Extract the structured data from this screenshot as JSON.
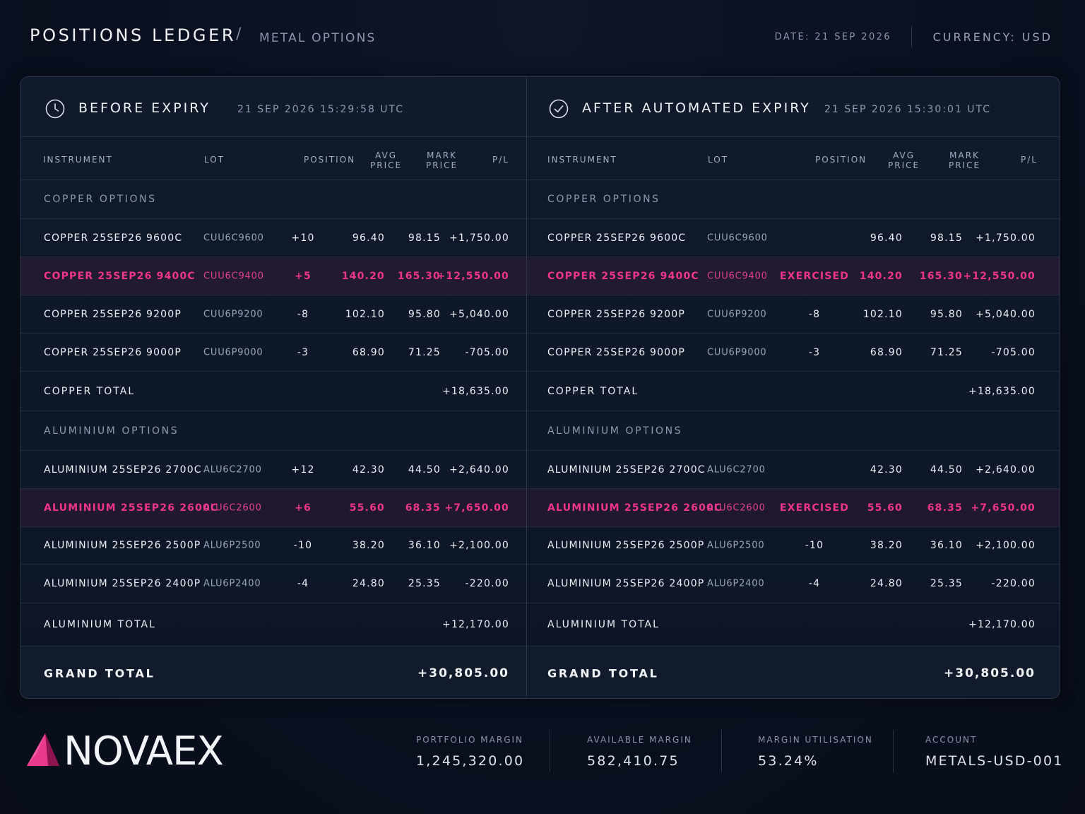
{
  "header": {
    "title": "POSITIONS LEDGER",
    "separator": "/",
    "subtitle": "METAL OPTIONS",
    "date": "DATE: 21 SEP 2026",
    "currency": "CURRENCY: USD"
  },
  "columns": {
    "instrument": "INSTRUMENT",
    "lot": "LOT",
    "position": "POSITION",
    "avg_l1": "AVG",
    "avg_l2": "PRICE",
    "mark_l1": "MARK",
    "mark_l2": "PRICE",
    "pl": "P/L"
  },
  "before": {
    "title": "BEFORE EXPIRY",
    "timestamp": "21 SEP 2026 15:29:58 UTC",
    "icon": "clock-icon",
    "copper_group": "COPPER OPTIONS",
    "copper_rows": [
      {
        "instrument": "COPPER 25SEP26 9600C",
        "lot": "CUU6C9600",
        "position": "+10",
        "avg": "96.40",
        "mark": "98.15",
        "pl": "+1,750.00"
      },
      {
        "instrument": "COPPER 25SEP26 9400C",
        "lot": "CUU6C9400",
        "position": "+5",
        "avg": "140.20",
        "mark": "165.30",
        "pl": "+12,550.00"
      },
      {
        "instrument": "COPPER 25SEP26 9200P",
        "lot": "CUU6P9200",
        "position": "-8",
        "avg": "102.10",
        "mark": "95.80",
        "pl": "+5,040.00"
      },
      {
        "instrument": "COPPER 25SEP26 9000P",
        "lot": "CUU6P9000",
        "position": "-3",
        "avg": "68.90",
        "mark": "71.25",
        "pl": "-705.00"
      }
    ],
    "copper_total_label": "COPPER TOTAL",
    "copper_total": "+18,635.00",
    "aluminium_group": "ALUMINIUM OPTIONS",
    "aluminium_rows": [
      {
        "instrument": "ALUMINIUM 25SEP26 2700C",
        "lot": "ALU6C2700",
        "position": "+12",
        "avg": "42.30",
        "mark": "44.50",
        "pl": "+2,640.00"
      },
      {
        "instrument": "ALUMINIUM 25SEP26 2600C",
        "lot": "ALU6C2600",
        "position": "+6",
        "avg": "55.60",
        "mark": "68.35",
        "pl": "+7,650.00"
      },
      {
        "instrument": "ALUMINIUM 25SEP26 2500P",
        "lot": "ALU6P2500",
        "position": "-10",
        "avg": "38.20",
        "mark": "36.10",
        "pl": "+2,100.00"
      },
      {
        "instrument": "ALUMINIUM 25SEP26 2400P",
        "lot": "ALU6P2400",
        "position": "-4",
        "avg": "24.80",
        "mark": "25.35",
        "pl": "-220.00"
      }
    ],
    "aluminium_total_label": "ALUMINIUM TOTAL",
    "aluminium_total": "+12,170.00",
    "grand_total_label": "GRAND TOTAL",
    "grand_total": "+30,805.00"
  },
  "after": {
    "title": "AFTER AUTOMATED EXPIRY",
    "timestamp": "21 SEP 2026 15:30:01 UTC",
    "icon": "check-circle-icon",
    "copper_group": "COPPER OPTIONS",
    "copper_rows": [
      {
        "instrument": "COPPER 25SEP26 9600C",
        "lot": "CUU6C9600",
        "position": "",
        "avg": "96.40",
        "mark": "98.15",
        "pl": "+1,750.00"
      },
      {
        "instrument": "COPPER 25SEP26 9400C",
        "lot": "CUU6C9400",
        "position": "EXERCISED",
        "avg": "140.20",
        "mark": "165.30",
        "pl": "+12,550.00"
      },
      {
        "instrument": "COPPER 25SEP26 9200P",
        "lot": "CUU6P9200",
        "position": "-8",
        "avg": "102.10",
        "mark": "95.80",
        "pl": "+5,040.00"
      },
      {
        "instrument": "COPPER 25SEP26 9000P",
        "lot": "CUU6P9000",
        "position": "-3",
        "avg": "68.90",
        "mark": "71.25",
        "pl": "-705.00"
      }
    ],
    "copper_total_label": "COPPER TOTAL",
    "copper_total": "+18,635.00",
    "aluminium_group": "ALUMINIUM OPTIONS",
    "aluminium_rows": [
      {
        "instrument": "ALUMINIUM 25SEP26 2700C",
        "lot": "ALU6C2700",
        "position": "",
        "avg": "42.30",
        "mark": "44.50",
        "pl": "+2,640.00"
      },
      {
        "instrument": "ALUMINIUM 25SEP26 2600C",
        "lot": "ALU6C2600",
        "position": "EXERCISED",
        "avg": "55.60",
        "mark": "68.35",
        "pl": "+7,650.00"
      },
      {
        "instrument": "ALUMINIUM 25SEP26 2500P",
        "lot": "ALU6P2500",
        "position": "-10",
        "avg": "38.20",
        "mark": "36.10",
        "pl": "+2,100.00"
      },
      {
        "instrument": "ALUMINIUM 25SEP26 2400P",
        "lot": "ALU6P2400",
        "position": "-4",
        "avg": "24.80",
        "mark": "25.35",
        "pl": "-220.00"
      }
    ],
    "aluminium_total_label": "ALUMINIUM TOTAL",
    "aluminium_total": "+12,170.00",
    "grand_total_label": "GRAND TOTAL",
    "grand_total": "+30,805.00"
  },
  "footer": {
    "logo_text": "NOVAEX",
    "logo_icon": "novaex-prism-logo",
    "stats": [
      {
        "label": "PORTFOLIO MARGIN",
        "value": "1,245,320.00"
      },
      {
        "label": "AVAILABLE MARGIN",
        "value": "582,410.75"
      },
      {
        "label": "MARGIN UTILISATION",
        "value": "53.24%"
      },
      {
        "label": "ACCOUNT",
        "value": "METALS-USD-001"
      }
    ]
  },
  "colors": {
    "background": "#0a1020",
    "panel": "#0f1929",
    "highlight": "#f0358b",
    "text": "#eceff4",
    "muted": "#8f99ae"
  }
}
